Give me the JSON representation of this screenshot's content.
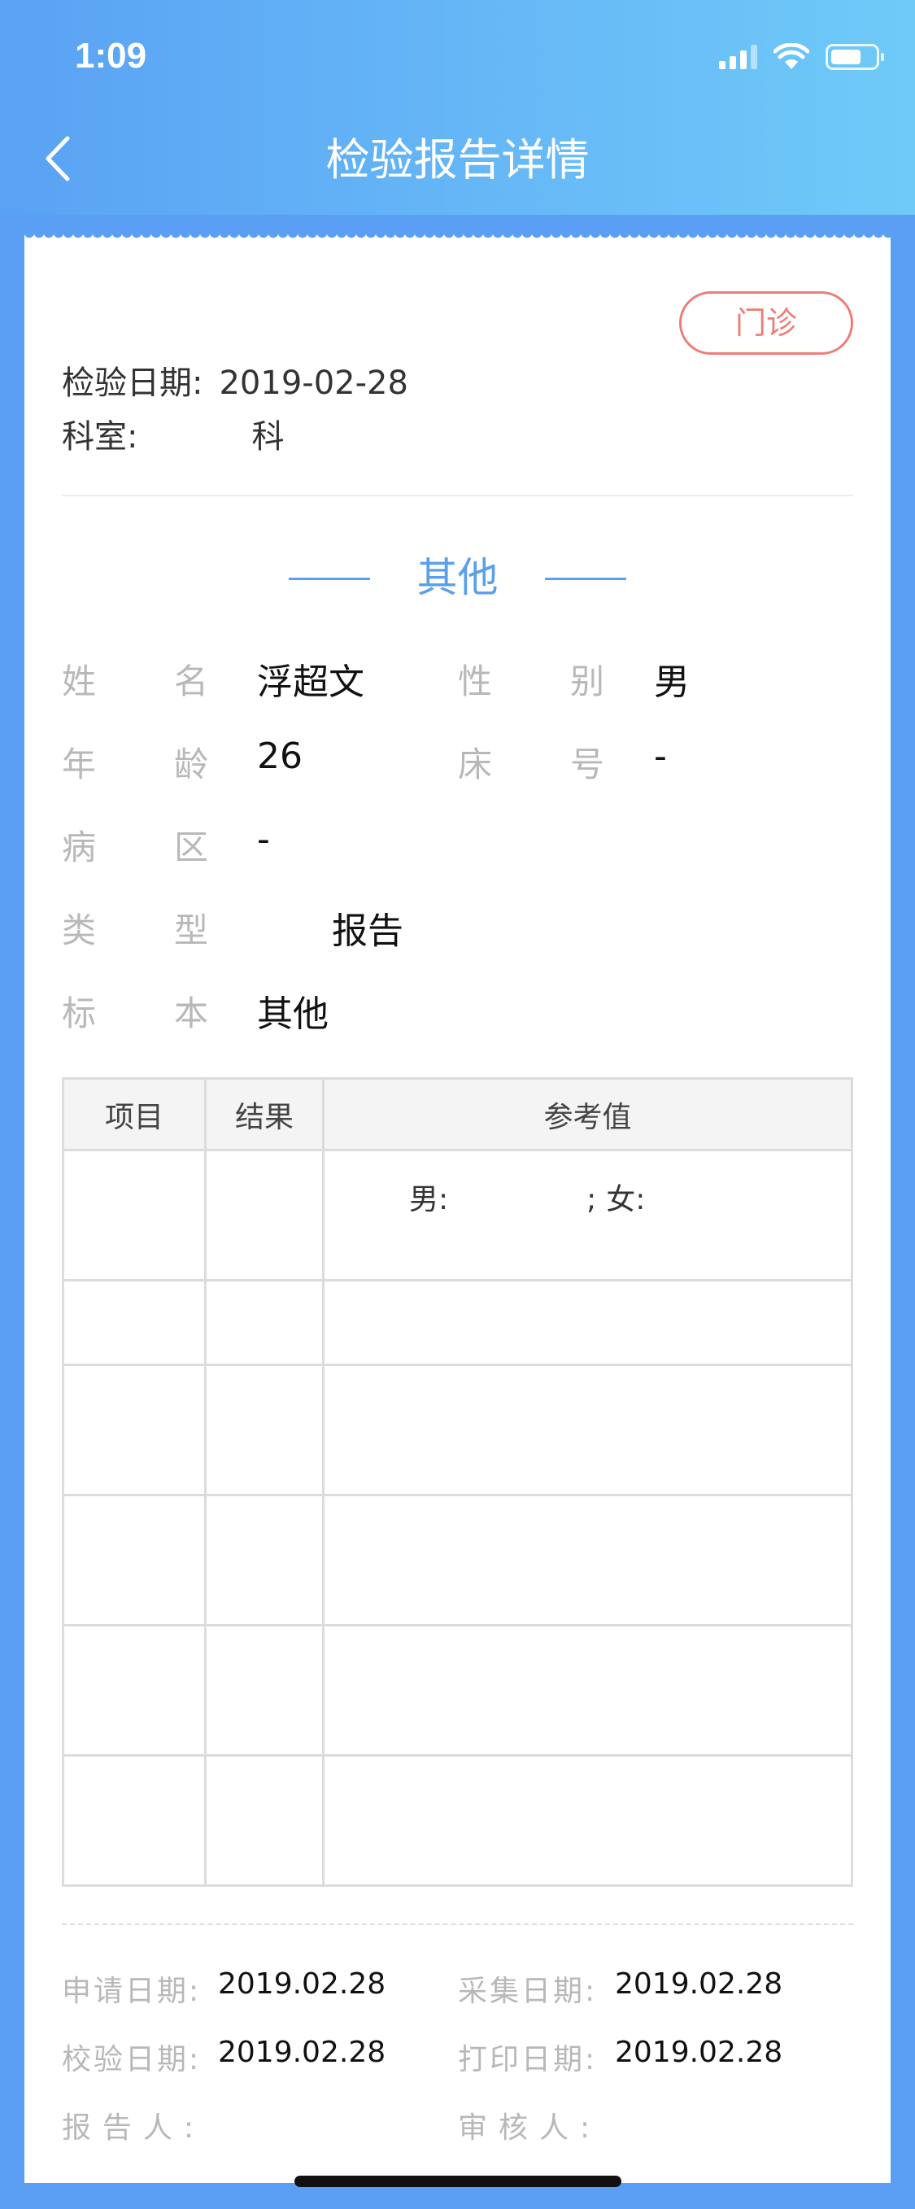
{
  "status_bar": {
    "time": "1:09"
  },
  "nav": {
    "title": "检验报告详情"
  },
  "badge": "门诊",
  "meta": {
    "date_label": "检验日期:",
    "date_value": "2019-02-28",
    "dept_label": "科室:",
    "dept_value": "科"
  },
  "section_title": "其他",
  "patient": {
    "name_label": "姓名",
    "name_value": "浮超文",
    "sex_label": "性别",
    "sex_value": "男",
    "age_label": "年龄",
    "age_value": "26",
    "bed_label": "床号",
    "bed_value": "-",
    "ward_label": "病区",
    "ward_value": "-",
    "type_label": "类型",
    "type_value": "报告",
    "sample_label": "标本",
    "sample_value": "其他"
  },
  "table": {
    "headers": [
      "项目",
      "结果",
      "参考值"
    ],
    "ref_male": "男:",
    "ref_sep": ";",
    "ref_female": "女:"
  },
  "footer": {
    "apply_label": "申请日期:",
    "apply_value": "2019.02.28",
    "collect_label": "采集日期:",
    "collect_value": "2019.02.28",
    "verify_label": "校验日期:",
    "verify_value": "2019.02.28",
    "print_label": "打印日期:",
    "print_value": "2019.02.28",
    "reporter_label": "报告人:",
    "auditor_label": "审核人:"
  }
}
